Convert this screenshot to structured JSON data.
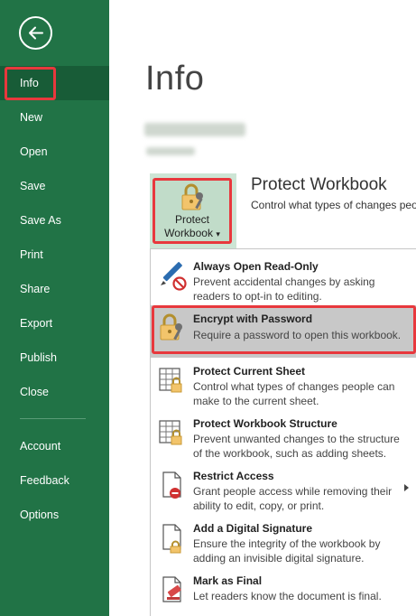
{
  "sidebar": {
    "items": [
      {
        "label": "Info",
        "name": "sidebar-item-info"
      },
      {
        "label": "New",
        "name": "sidebar-item-new"
      },
      {
        "label": "Open",
        "name": "sidebar-item-open"
      },
      {
        "label": "Save",
        "name": "sidebar-item-save"
      },
      {
        "label": "Save As",
        "name": "sidebar-item-save-as"
      },
      {
        "label": "Print",
        "name": "sidebar-item-print"
      },
      {
        "label": "Share",
        "name": "sidebar-item-share"
      },
      {
        "label": "Export",
        "name": "sidebar-item-export"
      },
      {
        "label": "Publish",
        "name": "sidebar-item-publish"
      },
      {
        "label": "Close",
        "name": "sidebar-item-close"
      },
      {
        "label": "Account",
        "name": "sidebar-item-account"
      },
      {
        "label": "Feedback",
        "name": "sidebar-item-feedback"
      },
      {
        "label": "Options",
        "name": "sidebar-item-options"
      }
    ],
    "active": "Info"
  },
  "main": {
    "title": "Info",
    "protect": {
      "button_line1": "Protect",
      "button_line2": "Workbook",
      "dropdown_glyph": "▾",
      "section_title": "Protect Workbook",
      "section_desc": "Control what types of changes peo"
    }
  },
  "menu": {
    "items": [
      {
        "title": "Always Open Read-Only",
        "desc": "Prevent accidental changes by asking readers to opt-in to editing.",
        "icon": "pencil-no-icon"
      },
      {
        "title": "Encrypt with Password",
        "desc": "Require a password to open this workbook.",
        "icon": "lock-key-icon"
      },
      {
        "title": "Protect Current Sheet",
        "desc": "Control what types of changes people can make to the current sheet.",
        "icon": "sheet-lock-icon"
      },
      {
        "title": "Protect Workbook Structure",
        "desc": "Prevent unwanted changes to the structure of the workbook, such as adding sheets.",
        "icon": "workbook-lock-icon"
      },
      {
        "title": "Restrict Access",
        "desc": "Grant people access while removing their ability to edit, copy, or print.",
        "icon": "restrict-access-icon"
      },
      {
        "title": "Add a Digital Signature",
        "desc": "Ensure the integrity of the workbook by adding an invisible digital signature.",
        "icon": "signature-icon"
      },
      {
        "title": "Mark as Final",
        "desc": "Let readers know the document is final.",
        "icon": "mark-final-icon"
      }
    ],
    "selected": "Encrypt with Password"
  },
  "colors": {
    "sidebar": "#217346",
    "sidebar_active": "#185c37",
    "highlight": "#e8383d",
    "selected_row": "#c8c8c8",
    "tile": "#cde5d5"
  }
}
